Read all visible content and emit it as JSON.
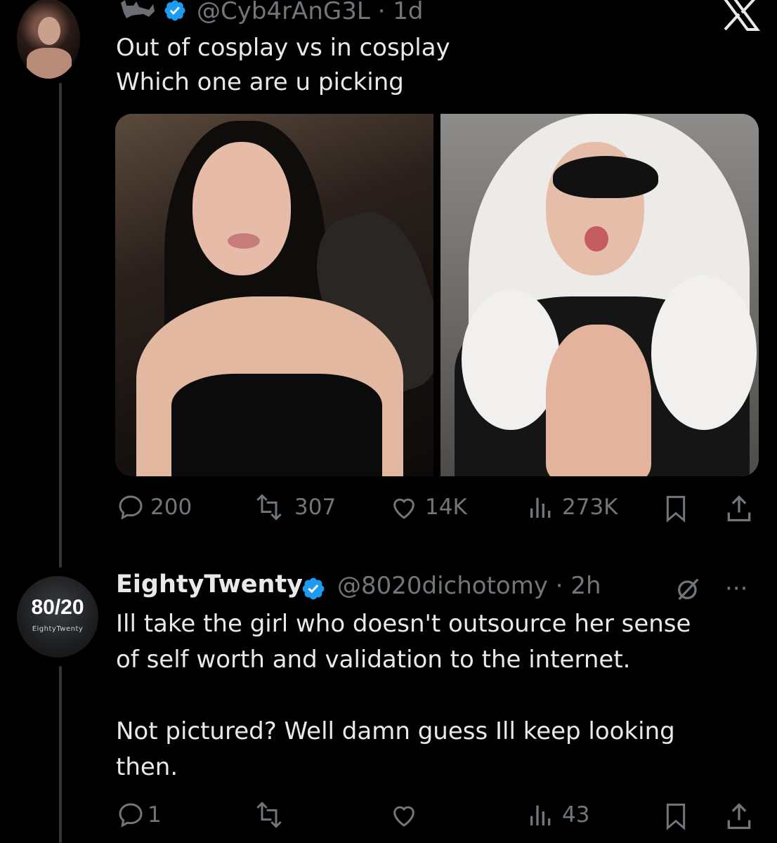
{
  "tweet": {
    "handle_line": "@Cyb4rAnG3L · 1d",
    "text_line1": "Out of cosplay vs in cosplay",
    "text_line2": "Which one are u picking",
    "stats": {
      "replies": "200",
      "retweets": "307",
      "likes": "14K",
      "views": "273K"
    }
  },
  "reply": {
    "avatar_big": "80/20",
    "avatar_small": "EightyTwenty",
    "name": "EightyTwenty",
    "handle_line": "@8020dichotomy · 2h",
    "more_label": "···",
    "text_line1": "Ill take the girl who doesn't outsource her sense",
    "text_line2": "of self worth and validation to the internet.",
    "text_line3": "Not pictured? Well damn guess Ill keep looking",
    "text_line4": "then.",
    "stats": {
      "replies": "1",
      "views": "43"
    }
  },
  "colors": {
    "background": "#000000",
    "text": "#e7e9ea",
    "secondary": "#71767b",
    "verified": "#1d9bf0"
  },
  "icons": [
    "cat-icon",
    "verified-icon",
    "x-logo-icon",
    "reply-icon",
    "retweet-icon",
    "like-icon",
    "views-icon",
    "bookmark-icon",
    "share-icon",
    "grok-icon",
    "more-icon"
  ]
}
